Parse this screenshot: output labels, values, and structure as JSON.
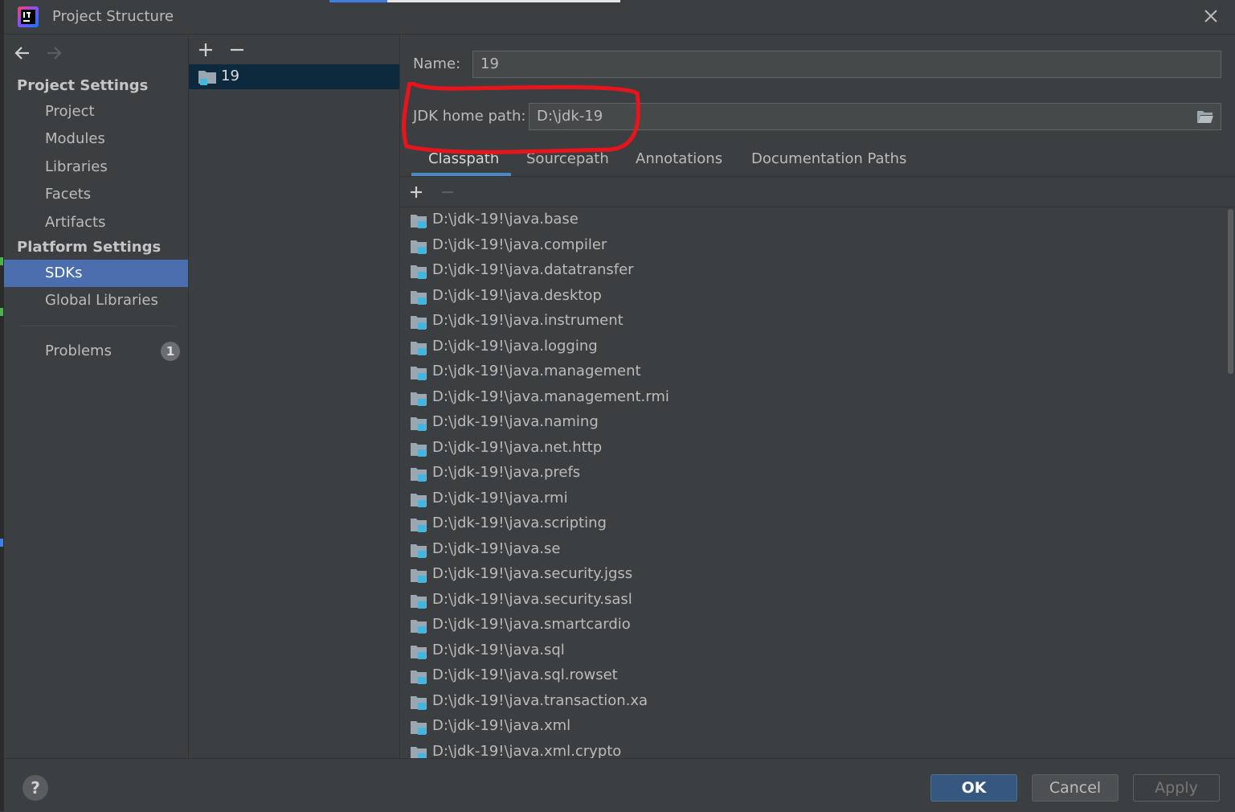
{
  "window": {
    "title": "Project Structure"
  },
  "colors": {
    "accent": "#4b6eaf",
    "selection": "#0d293e",
    "annotation": "#e8141c",
    "ok_button": "#365880"
  },
  "icons": {
    "app": "intellij-idea-icon",
    "close": "close-icon",
    "back": "arrow-left-icon",
    "forward": "arrow-right-icon",
    "add": "plus-icon",
    "remove": "minus-icon",
    "sdk": "jdk-folder-icon",
    "browse": "folder-open-icon",
    "module": "jar-module-icon",
    "help": "help-icon"
  },
  "sidebar": {
    "project_settings": "Project Settings",
    "project_items": [
      "Project",
      "Modules",
      "Libraries",
      "Facets",
      "Artifacts"
    ],
    "platform_settings": "Platform Settings",
    "platform_items": [
      "SDKs",
      "Global Libraries"
    ],
    "selected": "SDKs",
    "problems": {
      "label": "Problems",
      "count": "1"
    }
  },
  "sdk_list": {
    "items": [
      "19"
    ],
    "selected": "19"
  },
  "detail": {
    "name_label": "Name:",
    "name_value": "19",
    "jdk_label": "JDK home path:",
    "jdk_value": "D:\\jdk-19",
    "tabs": [
      "Classpath",
      "Sourcepath",
      "Annotations",
      "Documentation Paths"
    ],
    "active_tab": "Classpath",
    "classpath": [
      "D:\\jdk-19!\\java.base",
      "D:\\jdk-19!\\java.compiler",
      "D:\\jdk-19!\\java.datatransfer",
      "D:\\jdk-19!\\java.desktop",
      "D:\\jdk-19!\\java.instrument",
      "D:\\jdk-19!\\java.logging",
      "D:\\jdk-19!\\java.management",
      "D:\\jdk-19!\\java.management.rmi",
      "D:\\jdk-19!\\java.naming",
      "D:\\jdk-19!\\java.net.http",
      "D:\\jdk-19!\\java.prefs",
      "D:\\jdk-19!\\java.rmi",
      "D:\\jdk-19!\\java.scripting",
      "D:\\jdk-19!\\java.se",
      "D:\\jdk-19!\\java.security.jgss",
      "D:\\jdk-19!\\java.security.sasl",
      "D:\\jdk-19!\\java.smartcardio",
      "D:\\jdk-19!\\java.sql",
      "D:\\jdk-19!\\java.sql.rowset",
      "D:\\jdk-19!\\java.transaction.xa",
      "D:\\jdk-19!\\java.xml",
      "D:\\jdk-19!\\java.xml.crypto"
    ]
  },
  "footer": {
    "help": "?",
    "ok": "OK",
    "cancel": "Cancel",
    "apply": "Apply"
  }
}
